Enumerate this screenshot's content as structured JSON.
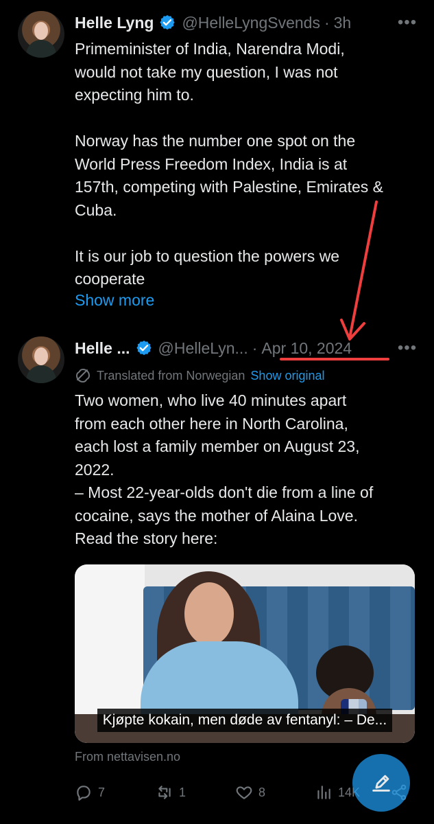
{
  "colors": {
    "background": "#000000",
    "text": "#e7e9ea",
    "secondary": "#71767b",
    "link": "#1d9bf0",
    "verified": "#1d9bf0",
    "annotation": "#ef3e3e"
  },
  "tweets": [
    {
      "display_name": "Helle Lyng",
      "handle": "@HelleLyngSvends",
      "time": "3h",
      "text": "Primeminister of India, Narendra Modi,\nwould not take my question, I was not\nexpecting him to.\n\nNorway has the number one spot on the\nWorld Press Freedom Index, India is at\n157th, competing with Palestine, Emirates &\nCuba.\n\nIt is our job to question the powers we\ncooperate",
      "show_more": "Show more"
    },
    {
      "display_name": "Helle ...",
      "handle": "@HelleLyn...",
      "time": "Apr 10, 2024",
      "translated_label": "Translated from Norwegian",
      "show_original": "Show original",
      "text": "Two women, who live 40 minutes apart\nfrom each other here in North Carolina,\neach lost a family member on August 23,\n2022.\n– Most 22-year-olds don't die from a line of\ncocaine, says the mother of Alaina Love.\nRead the story here:",
      "media_caption": "Kjøpte kokain, men døde av fentanyl: – De...",
      "media_source": "From nettavisen.no",
      "actions": {
        "reply": "7",
        "retweet": "1",
        "like": "8",
        "views": "14K"
      }
    }
  ],
  "icons": {
    "verified": "verified-badge-icon",
    "more": "more-options-icon",
    "translate": "translate-icon",
    "reply": "reply-icon",
    "retweet": "retweet-icon",
    "like": "heart-icon",
    "views": "views-icon",
    "share": "share-icon",
    "compose": "compose-icon"
  }
}
